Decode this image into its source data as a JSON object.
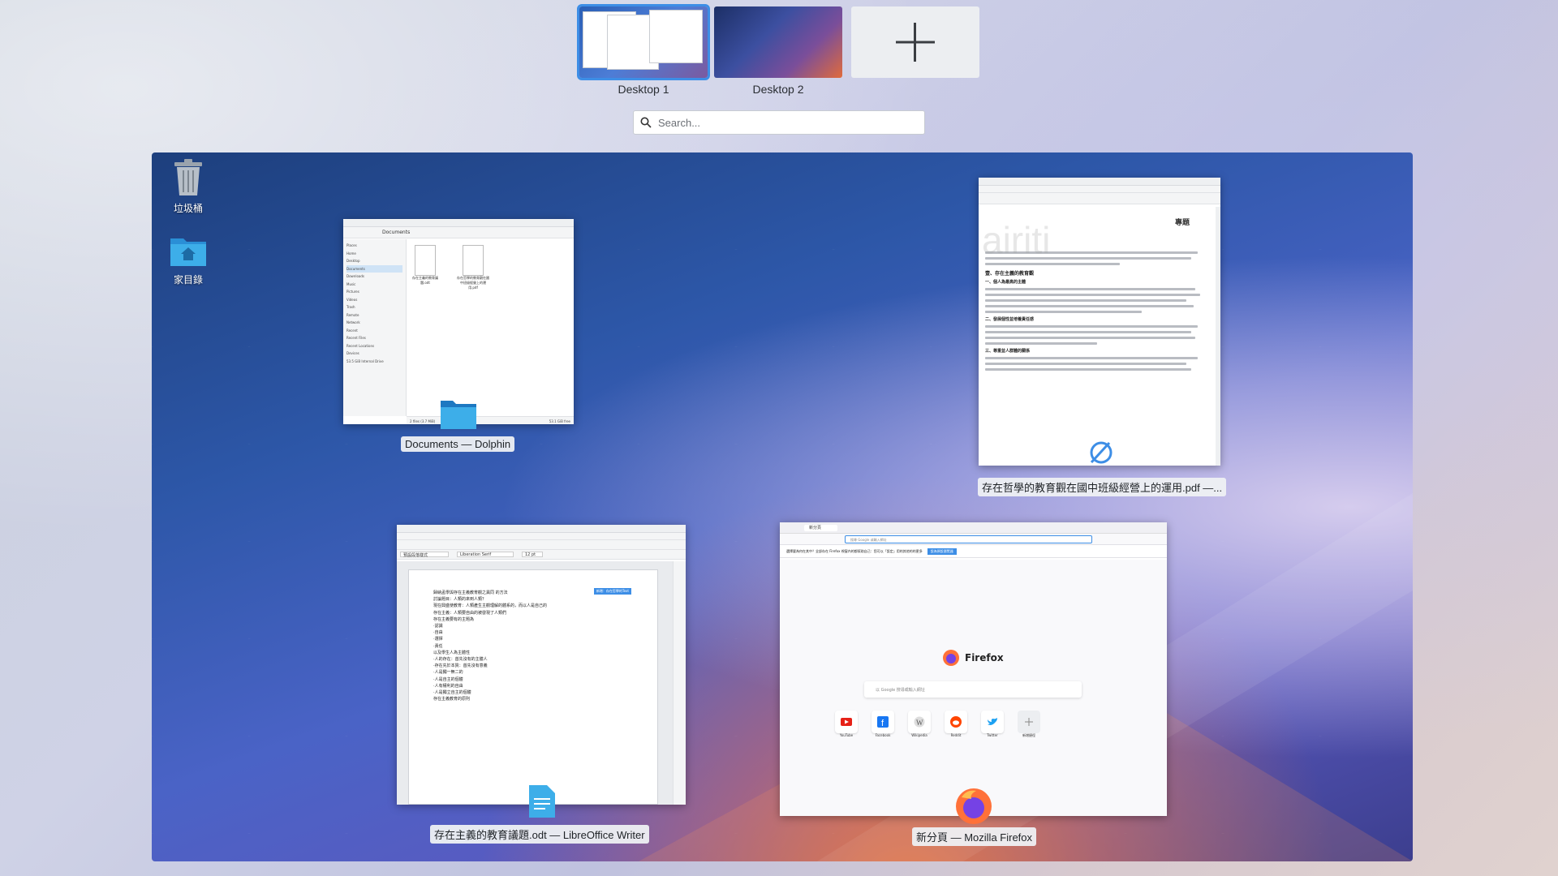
{
  "desktops": [
    {
      "label": "Desktop 1",
      "active": true
    },
    {
      "label": "Desktop 2",
      "active": false
    }
  ],
  "add_desktop_icon": "plus-icon",
  "search": {
    "placeholder": "Search..."
  },
  "desktop_icons": [
    {
      "label": "垃圾桶",
      "icon": "trash-icon"
    },
    {
      "label": "家目錄",
      "icon": "home-folder-icon"
    }
  ],
  "windows": {
    "dolphin": {
      "caption": "Documents — Dolphin",
      "breadcrumb": "Documents",
      "places": [
        "Places",
        "Home",
        "Desktop",
        "Documents",
        "Downloads",
        "Music",
        "Pictures",
        "Videos",
        "Trash",
        "Remote",
        "Network",
        "Recent",
        "Recent Files",
        "Recent Locations",
        "Devices",
        "53.5 GiB Internal Drive"
      ],
      "files": [
        "存在主義的教育議題.odt",
        "存在哲學的教育觀在國中班級經營上的運用.pdf"
      ],
      "status_left": "2 files (3.7 MiB)",
      "status_right": "53.1 GiB free"
    },
    "okular": {
      "caption": "存在哲學的教育觀在國中班級經營上的運用.pdf —...",
      "watermark": "airiti",
      "header_right": "專題",
      "sections": [
        "壹、存在主義的教育觀",
        "一、個人為最高的主體",
        "二、發展個性並培養責任感",
        "三、尊重並人群體的關係"
      ]
    },
    "writer": {
      "caption": "存在主義的教育議題.odt — LibreOffice Writer",
      "style_box": "預設段落樣式",
      "font_box": "Liberation Serif",
      "size_box": "12 pt",
      "comment_tag": "新增：存在哲學的Text",
      "lines": [
        "歸納孟學與存在主義教育觀之異同 的方法",
        "討論題目：人類的來到人類？",
        "現在興盛使教育：人類產生主觀理解的體系的，而以人是自己的",
        "存在主義：人類要自由的被發現了人類們",
        "存在主義要有的主題為",
        "·認識",
        "·自由",
        "·選擇",
        "·責任",
        "以及學生人為主體性",
        "·人的存在：首先沒有的主體人",
        "·存在先於本質：首先沒有意義",
        "·人是獨一無二的",
        "·人是自主的個體",
        "·人有權利的自由",
        "·人是獨立自主的個體",
        "存在主義教育的原則"
      ]
    },
    "firefox": {
      "caption": "新分頁 — Mozilla Firefox",
      "tab_title": "新分頁",
      "url_placeholder": "搜尋 Google 或輸入網址",
      "notification": "選擇要為何在其中？全部存在 Firefox 視窗內的都幫助自己：您可以「設定」用的其他的的更多",
      "notification_button": "設為預設瀏覽器",
      "brand": "Firefox",
      "search_placeholder": "以 Google 搜尋或輸入網址",
      "shortcuts": [
        {
          "label": "YouTube",
          "icon": "youtube-icon",
          "color": "#e62117"
        },
        {
          "label": "Facebook",
          "icon": "facebook-icon",
          "color": "#1877f2"
        },
        {
          "label": "Wikipedia",
          "icon": "wikipedia-icon",
          "color": "#666666"
        },
        {
          "label": "Reddit",
          "icon": "reddit-icon",
          "color": "#ff4500"
        },
        {
          "label": "Twitter",
          "icon": "twitter-icon",
          "color": "#1da1f2"
        },
        {
          "label": "新增捷徑",
          "icon": "plus-icon",
          "color": "#888888"
        }
      ]
    }
  },
  "colors": {
    "accent": "#3d8ee6"
  }
}
